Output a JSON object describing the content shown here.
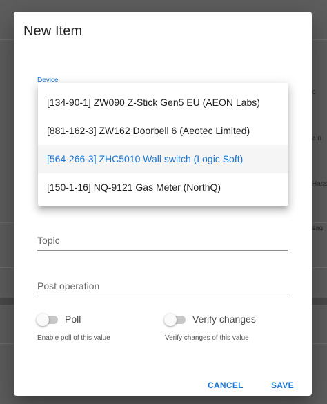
{
  "dialog": {
    "title": "New Item"
  },
  "device_field": {
    "label": "Device"
  },
  "device_menu": {
    "options": [
      "[134-90-1] ZW090 Z-Stick Gen5 EU (AEON Labs)",
      "[881-162-3] ZW162 Doorbell 6 (Aeotec Limited)",
      "[564-266-3] ZHC5010 Wall switch (Logic Soft)",
      "[150-1-16] NQ-9121 Gas Meter (NorthQ)"
    ],
    "selected_index": 2
  },
  "topic_field": {
    "placeholder": "Topic"
  },
  "post_operation_field": {
    "placeholder": "Post operation"
  },
  "poll_toggle": {
    "label": "Poll",
    "help": "Enable poll of this value",
    "checked": false
  },
  "verify_toggle": {
    "label": "Verify changes",
    "help": "Verify changes of this value",
    "checked": false
  },
  "actions": {
    "cancel_label": "CANCEL",
    "save_label": "SAVE"
  },
  "background": {
    "fragments": [
      "c",
      "a n",
      "Hass",
      "sag"
    ]
  },
  "colors": {
    "accent": "#1976d2",
    "overlay": "#5f5f5f"
  }
}
